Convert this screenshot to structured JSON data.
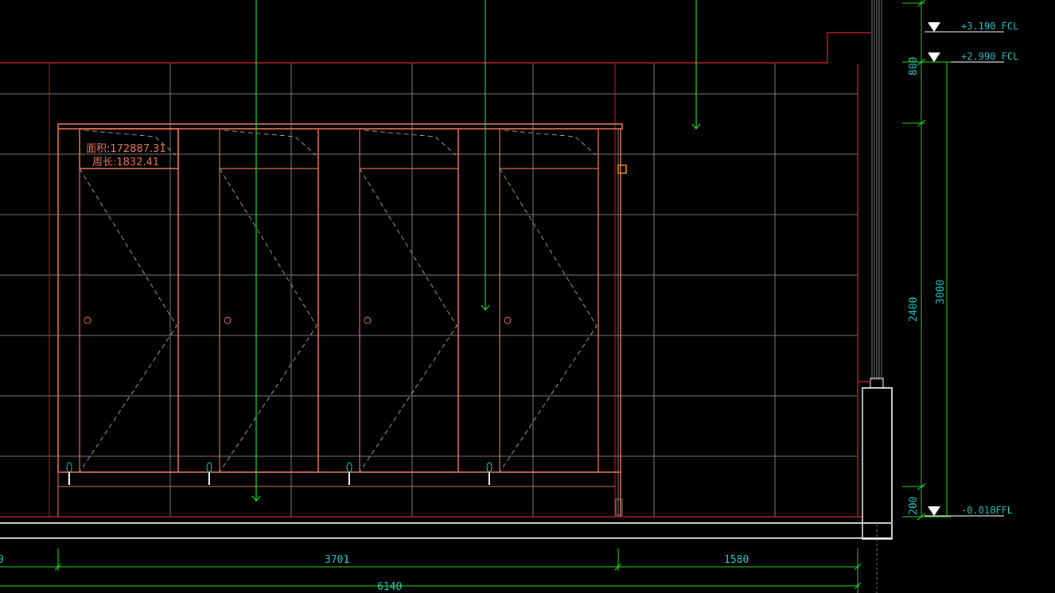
{
  "drawing": {
    "colors": {
      "background": "#000000",
      "grid": "#7a7a7a",
      "partition": "#e8775a",
      "wall": "#c02020",
      "dimension": "#22dd22",
      "dimension_text": "#22c8c8",
      "highlight": "#e8a000",
      "white": "#ffffff",
      "door_swing": "#9a9a9a"
    },
    "annotation": {
      "area_label": "面积:172887.31",
      "perimeter_label": "周长:1832.41"
    },
    "levels": [
      {
        "label": "+3.190 FCL"
      },
      {
        "label": "+2.990 FCL"
      },
      {
        "label": "-0.010FFL"
      }
    ],
    "vertical_dimensions": {
      "inner": [
        "800",
        "2400",
        "200"
      ],
      "outer": [
        "3000"
      ]
    },
    "horizontal_dimensions": {
      "row1": [
        "0",
        "3701",
        "1580"
      ],
      "row2": [
        "6140"
      ]
    },
    "stalls": {
      "count": 4
    }
  }
}
